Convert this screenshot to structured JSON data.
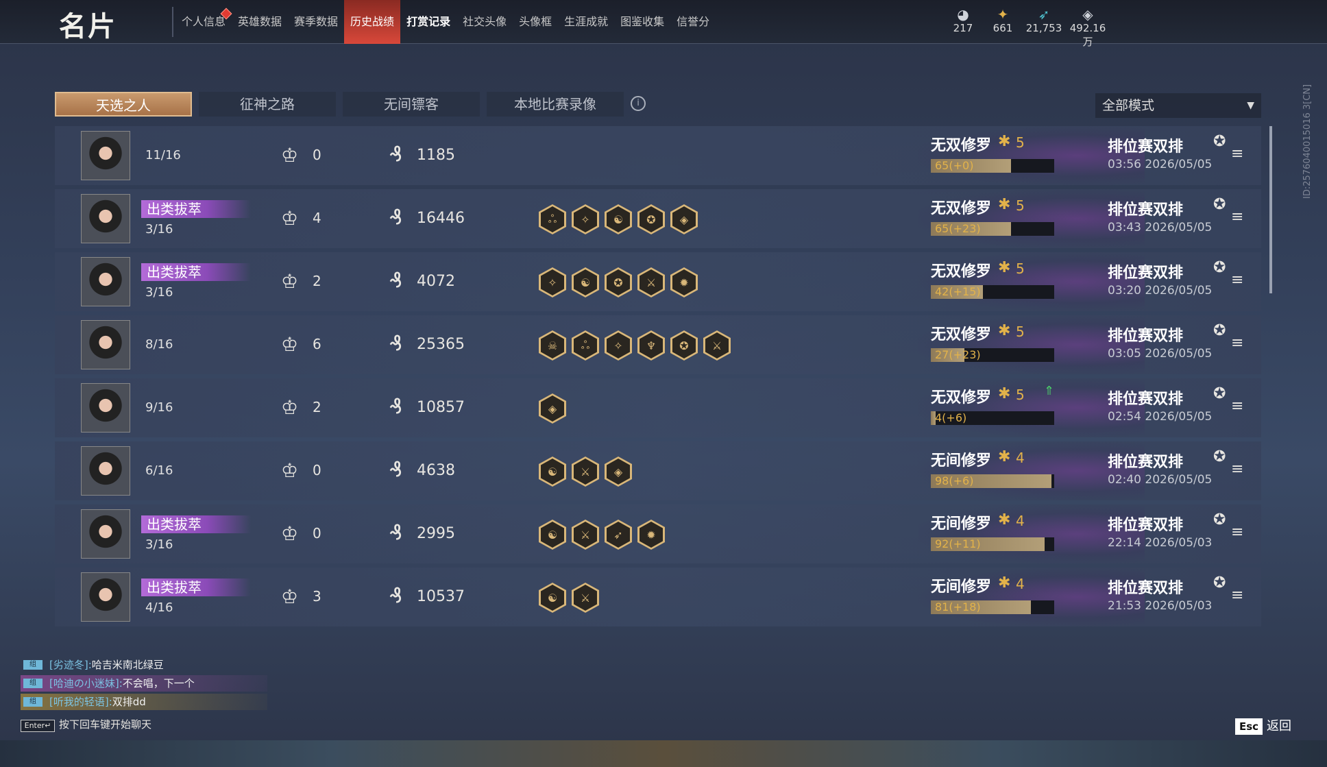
{
  "header": {
    "title": "名片",
    "nav": [
      {
        "label": "个人信息",
        "badge": true
      },
      {
        "label": "英雄数据"
      },
      {
        "label": "赛季数据"
      },
      {
        "label": "历史战绩",
        "active": true
      },
      {
        "label": "打赏记录",
        "bold": true
      },
      {
        "label": "社交头像"
      },
      {
        "label": "头像框"
      },
      {
        "label": "生涯成就"
      },
      {
        "label": "图鉴收集"
      },
      {
        "label": "信誉分"
      }
    ],
    "currencies": [
      {
        "icon": "mask-icon",
        "value": "217"
      },
      {
        "icon": "ticket-icon",
        "value": "661"
      },
      {
        "icon": "feather-icon",
        "value": "21,753"
      },
      {
        "icon": "diamond-icon",
        "value": "492.16万"
      }
    ]
  },
  "tabs": [
    "天选之人",
    "征神之路",
    "无间镖客",
    "本地比赛录像"
  ],
  "mode_select": {
    "value": "全部模式"
  },
  "side_id": "ID:2576040015016 3[CN]",
  "matches": [
    {
      "honor": "",
      "rank": "11/16",
      "kills": "0",
      "damage": "1185",
      "badges": [],
      "tier": "无双修罗",
      "tier_level": "5",
      "bar_text": "65(+0)",
      "bar_fill": 0.65,
      "up": false,
      "mode": "排位赛双排",
      "time": "03:56  2026/05/05"
    },
    {
      "honor": "出类拔萃",
      "rank": "3/16",
      "kills": "4",
      "damage": "16446",
      "badges": [
        "ஃ",
        "✧",
        "☯",
        "✪",
        "◈"
      ],
      "tier": "无双修罗",
      "tier_level": "5",
      "bar_text": "65(+23)",
      "bar_fill": 0.65,
      "up": false,
      "mode": "排位赛双排",
      "time": "03:43  2026/05/05"
    },
    {
      "honor": "出类拔萃",
      "rank": "3/16",
      "kills": "2",
      "damage": "4072",
      "badges": [
        "✧",
        "☯",
        "✪",
        "⚔",
        "✹"
      ],
      "tier": "无双修罗",
      "tier_level": "5",
      "bar_text": "42(+15)",
      "bar_fill": 0.42,
      "up": false,
      "mode": "排位赛双排",
      "time": "03:20  2026/05/05"
    },
    {
      "honor": "",
      "rank": "8/16",
      "kills": "6",
      "damage": "25365",
      "badges": [
        "☠",
        "ஃ",
        "✧",
        "♆",
        "✪",
        "⚔"
      ],
      "tier": "无双修罗",
      "tier_level": "5",
      "bar_text": "27(+23)",
      "bar_fill": 0.27,
      "up": false,
      "mode": "排位赛双排",
      "time": "03:05  2026/05/05"
    },
    {
      "honor": "",
      "rank": "9/16",
      "kills": "2",
      "damage": "10857",
      "badges": [
        "◈"
      ],
      "tier": "无双修罗",
      "tier_level": "5",
      "bar_text": "4(+6)",
      "bar_fill": 0.04,
      "up": true,
      "mode": "排位赛双排",
      "time": "02:54  2026/05/05"
    },
    {
      "honor": "",
      "rank": "6/16",
      "kills": "0",
      "damage": "4638",
      "badges": [
        "☯",
        "⚔",
        "◈"
      ],
      "tier": "无间修罗",
      "tier_level": "4",
      "bar_text": "98(+6)",
      "bar_fill": 0.98,
      "up": false,
      "mode": "排位赛双排",
      "time": "02:40  2026/05/05"
    },
    {
      "honor": "出类拔萃",
      "rank": "3/16",
      "kills": "0",
      "damage": "2995",
      "badges": [
        "☯",
        "⚔",
        "➶",
        "✹"
      ],
      "tier": "无间修罗",
      "tier_level": "4",
      "bar_text": "92(+11)",
      "bar_fill": 0.92,
      "up": false,
      "mode": "排位赛双排",
      "time": "22:14  2026/05/03"
    },
    {
      "honor": "出类拔萃",
      "rank": "4/16",
      "kills": "3",
      "damage": "10537",
      "badges": [
        "☯",
        "⚔"
      ],
      "tier": "无间修罗",
      "tier_level": "4",
      "bar_text": "81(+18)",
      "bar_fill": 0.81,
      "up": false,
      "mode": "排位赛双排",
      "time": "21:53  2026/05/03"
    }
  ],
  "chat": [
    {
      "name": "[劣迹冬]:",
      "msg": "哈吉米南北绿豆"
    },
    {
      "name": "[哈迪の小迷妹]:",
      "msg": "不会唱，下一个"
    },
    {
      "name": "[听我的轻语]:",
      "msg": "双排dd"
    }
  ],
  "enter_hint": {
    "key": "Enter↵",
    "text": "按下回车键开始聊天"
  },
  "esc": {
    "key": "Esc",
    "label": "返回"
  }
}
